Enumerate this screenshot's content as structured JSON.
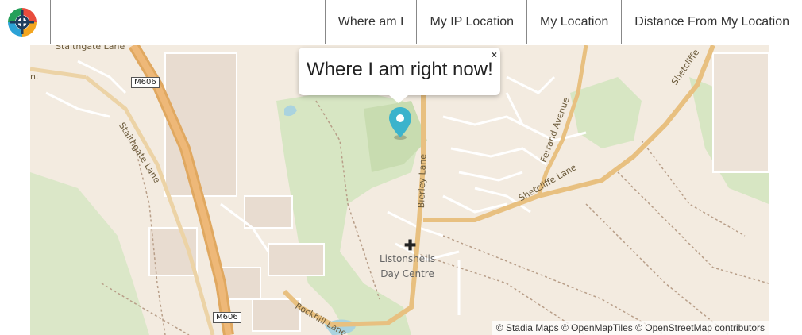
{
  "nav": {
    "items": [
      {
        "label": "Where am I"
      },
      {
        "label": "My IP Location"
      },
      {
        "label": "My Location"
      },
      {
        "label": "Distance From My Location"
      }
    ]
  },
  "popup": {
    "text": "Where I am right now!",
    "close_label": "×"
  },
  "map": {
    "labels": {
      "stainsgate_lane_top": "Staithgate Lane",
      "stainsgate_lane": "Staithgate Lane",
      "m606_top": "M606",
      "m606_bottom": "M606",
      "bierley_lane": "Bierley Lane",
      "ferrand_avenue": "Ferrand Avenue",
      "shetcliffe_lane": "Shetcliffe Lane",
      "shetcliffe_top": "Shetcliffe",
      "rockhill_lane": "Rockhill Lane",
      "poi_line1": "Listonshells",
      "poi_line2": "Day Centre",
      "left_edge": "nt"
    },
    "attribution": "© Stadia Maps © OpenMapTiles © OpenStreetMap contributors"
  },
  "colors": {
    "map_bg": "#f3ebe0",
    "park": "#d7e6c3",
    "road_major": "#e8c080",
    "motorway": "#e0a860",
    "water": "#aad3df",
    "marker": "#3bb3cc"
  }
}
